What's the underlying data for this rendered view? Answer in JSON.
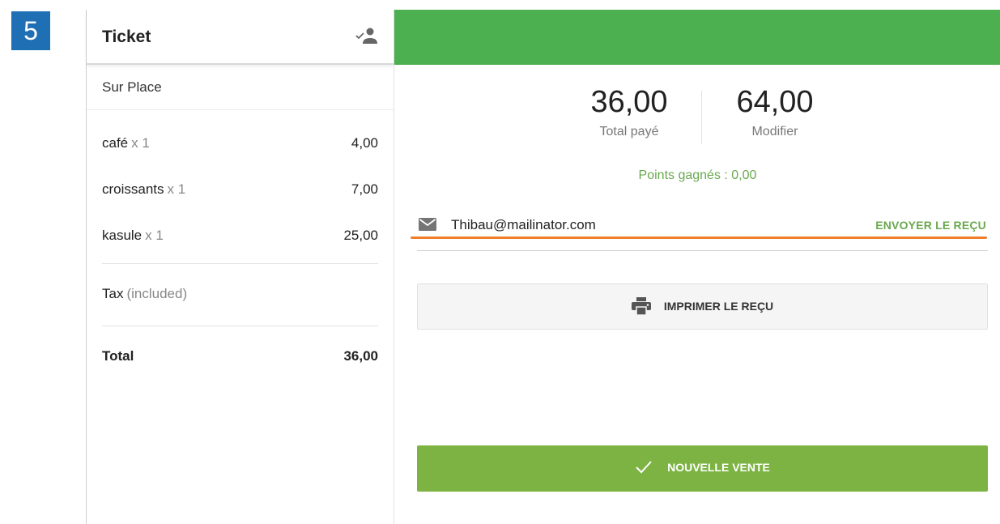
{
  "step": {
    "number": "5"
  },
  "ticket": {
    "title": "Ticket",
    "dining_option": "Sur Place",
    "items": [
      {
        "name": "café",
        "qty": "x 1",
        "price": "4,00"
      },
      {
        "name": "croissants",
        "qty": "x 1",
        "price": "7,00"
      },
      {
        "name": "kasule",
        "qty": "x 1",
        "price": "25,00"
      }
    ],
    "tax": {
      "label": "Tax",
      "note": "(included)"
    },
    "total": {
      "label": "Total",
      "value": "36,00"
    }
  },
  "payment": {
    "paid_amount": "36,00",
    "paid_label": "Total payé",
    "change_amount": "64,00",
    "change_label": "Modifier",
    "points": "Points gagnés : 0,00",
    "email": "Thibau@mailinator.com",
    "send_receipt_label": "ENVOYER LE REÇU",
    "print_receipt_label": "IMPRIMER LE REÇU",
    "new_sale_label": "NOUVELLE VENTE"
  },
  "colors": {
    "header_green": "#4caf50",
    "button_green": "#7cb342",
    "accent_text_green": "#6aa84f",
    "highlight_orange": "#f07f2c",
    "step_badge_blue": "#1f6fb5"
  },
  "icons": {
    "customer": "add-customer-icon",
    "mail": "mail-icon",
    "printer": "printer-icon",
    "check": "check-icon"
  }
}
